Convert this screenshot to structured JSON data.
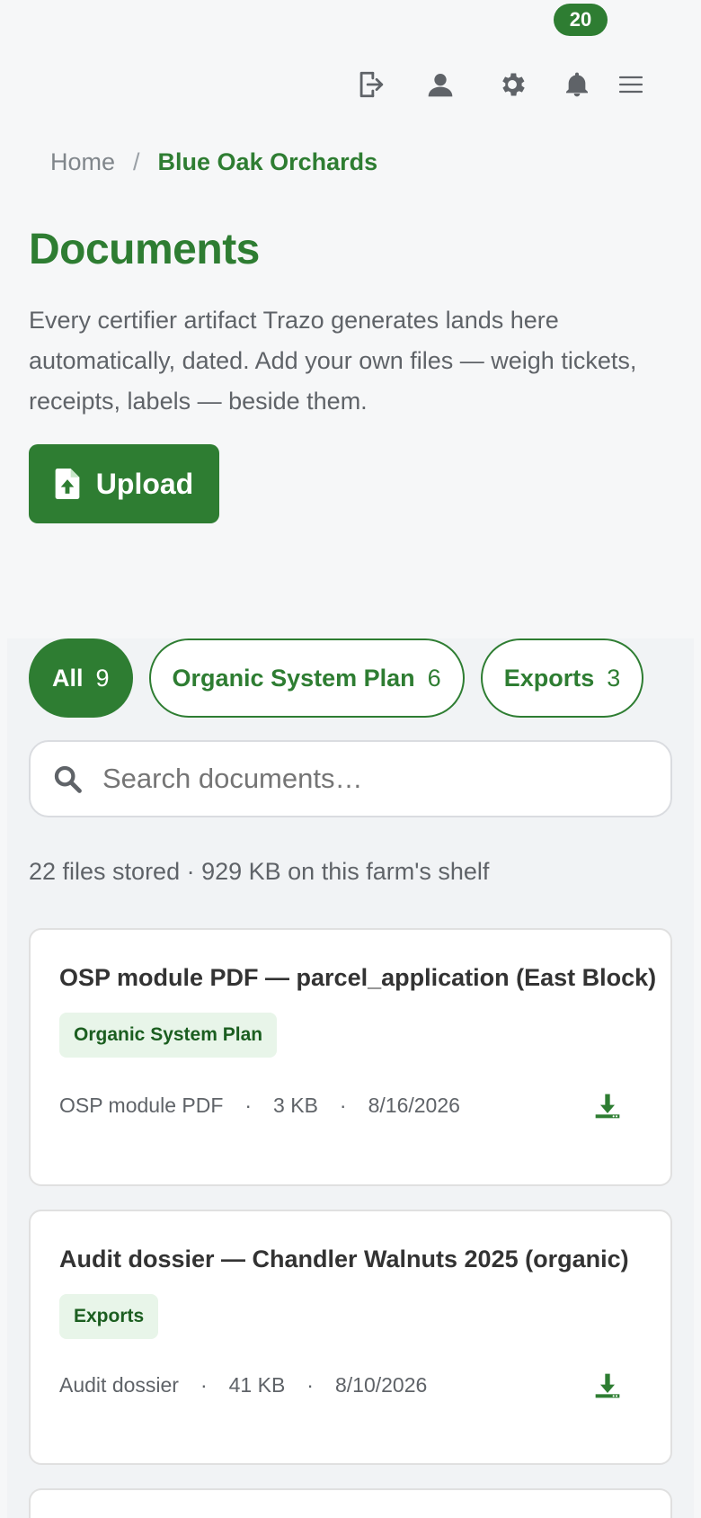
{
  "topbar": {
    "icons": [
      "logout-icon",
      "user-icon",
      "settings-icon",
      "bell-icon",
      "menu-icon"
    ],
    "notification_count": "20"
  },
  "breadcrumb": {
    "home": "Home",
    "separator": "/",
    "current": "Blue Oak Orchards"
  },
  "page": {
    "title": "Documents",
    "description": "Every certifier artifact Trazo generates lands here automatically, dated. Add your own files — weigh tickets, receipts, labels — beside them.",
    "upload_label": "Upload"
  },
  "filters": [
    {
      "label": "All",
      "count": "9",
      "active": true
    },
    {
      "label": "Organic System Plan",
      "count": "6",
      "active": false
    },
    {
      "label": "Exports",
      "count": "3",
      "active": false
    }
  ],
  "search": {
    "placeholder": "Search documents…",
    "value": ""
  },
  "stats": "22 files stored · 929 KB on this farm's shelf",
  "documents": [
    {
      "title": "OSP module PDF — parcel_application (East Block)",
      "tag": "Organic System Plan",
      "type": "OSP module PDF",
      "size": "3 KB",
      "date": "8/16/2026"
    },
    {
      "title": "Audit dossier — Chandler Walnuts 2025 (organic)",
      "tag": "Exports",
      "type": "Audit dossier",
      "size": "41 KB",
      "date": "8/10/2026"
    }
  ],
  "meta_separator": "·",
  "colors": {
    "brand": "#2e7d32",
    "tag_bg": "#e8f5e9",
    "tag_text": "#1b5e20",
    "background": "#f6f7f8"
  }
}
